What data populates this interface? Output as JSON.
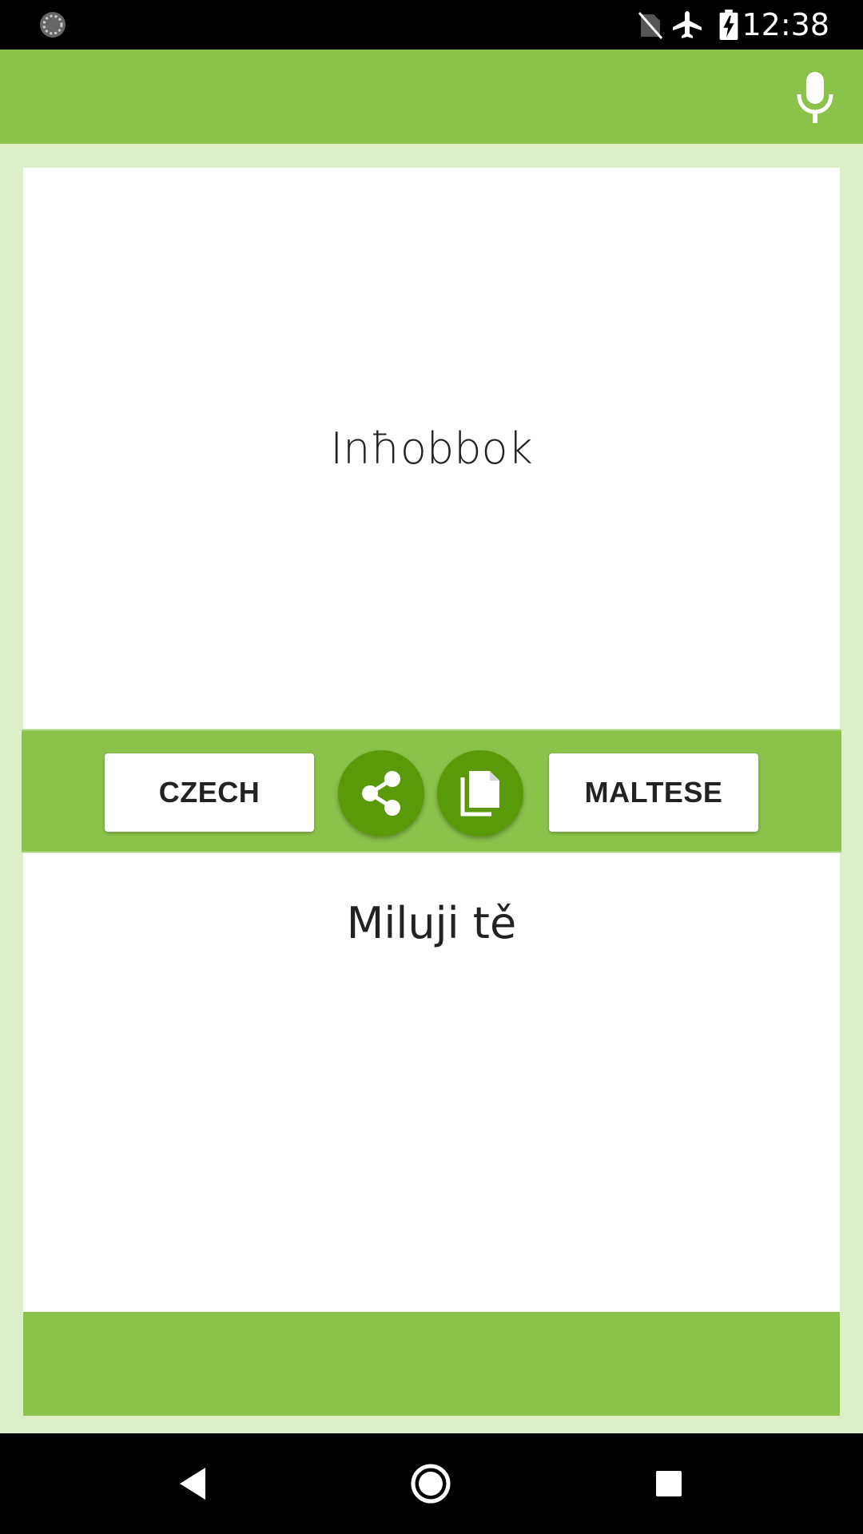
{
  "status_bar": {
    "time": "12:38",
    "icons": [
      "sync-icon",
      "no-sim-icon",
      "airplane-mode-icon",
      "battery-charging-icon"
    ]
  },
  "toolbar": {
    "icons": [
      "microphone-icon"
    ]
  },
  "source": {
    "text": "Inħobbok"
  },
  "actions": {
    "source_language": "CZECH",
    "target_language": "MALTESE",
    "icons": [
      "share-icon",
      "copy-icon"
    ]
  },
  "target": {
    "text": "Miluji tě"
  },
  "nav": {
    "icons": [
      "back-icon",
      "home-icon",
      "recents-icon"
    ]
  },
  "colors": {
    "primary_green": "#8bc34a",
    "dark_green": "#5a9a0a",
    "background_green": "#dcefc8"
  }
}
